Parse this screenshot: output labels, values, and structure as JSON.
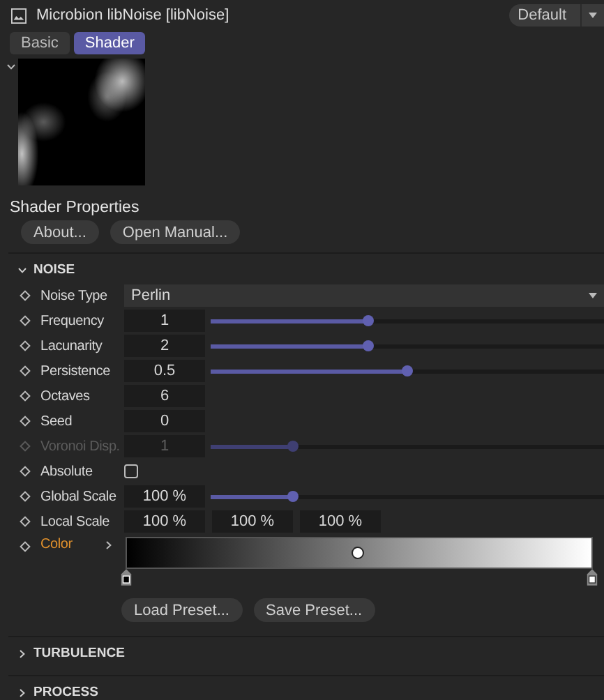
{
  "header": {
    "title": "Microbion libNoise [libNoise]",
    "preset": "Default"
  },
  "tabs": [
    {
      "label": "Basic",
      "selected": false
    },
    {
      "label": "Shader",
      "selected": true
    }
  ],
  "preview": {
    "expanded": true
  },
  "shader_properties": {
    "title": "Shader Properties",
    "buttons": [
      "About...",
      "Open Manual..."
    ]
  },
  "sections": [
    {
      "title": "NOISE",
      "expanded": true,
      "rows": [
        {
          "kind": "dropdown",
          "label": "Noise Type",
          "value": "Perlin",
          "disabled": false,
          "highlighted": false
        },
        {
          "kind": "slider",
          "label": "Frequency",
          "value": "1",
          "level": 0.4,
          "disabled": false,
          "highlighted": false
        },
        {
          "kind": "slider",
          "label": "Lacunarity",
          "value": "2",
          "level": 0.4,
          "disabled": false,
          "highlighted": false
        },
        {
          "kind": "slider",
          "label": "Persistence",
          "value": "0.5",
          "level": 0.5,
          "disabled": false,
          "highlighted": false
        },
        {
          "kind": "number",
          "label": "Octaves",
          "value": "6",
          "disabled": false,
          "highlighted": false
        },
        {
          "kind": "number",
          "label": "Seed",
          "value": "0",
          "disabled": false,
          "highlighted": false
        },
        {
          "kind": "slider",
          "label": "Voronoi Disp.",
          "value": "1",
          "level": 0.21,
          "disabled": true,
          "highlighted": false
        },
        {
          "kind": "checkbox",
          "label": "Absolute",
          "checked": false,
          "disabled": false,
          "highlighted": false
        },
        {
          "kind": "slider",
          "label": "Global Scale",
          "value": "100 %",
          "level": 0.21,
          "disabled": false,
          "highlighted": false
        },
        {
          "kind": "vector",
          "label": "Local Scale",
          "values": [
            "100 %",
            "100 %",
            "100 %"
          ],
          "disabled": false,
          "highlighted": false
        },
        {
          "kind": "gradient",
          "label": "Color",
          "level": 0.5,
          "disabled": false,
          "highlighted": true
        }
      ],
      "buttons": [
        "Load Preset...",
        "Save Preset..."
      ]
    },
    {
      "title": "TURBULENCE",
      "expanded": false
    },
    {
      "title": "PROCESS",
      "expanded": false
    }
  ]
}
